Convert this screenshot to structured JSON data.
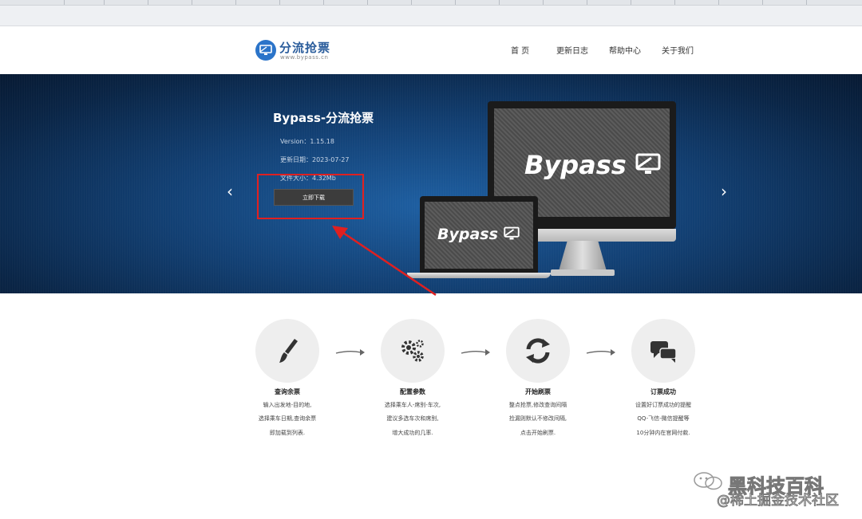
{
  "header": {
    "logo_text": "分流抢票",
    "logo_domain": "www.bypass.cn",
    "nav": [
      {
        "label": "首  页"
      },
      {
        "label": "更新日志"
      },
      {
        "label": "帮助中心"
      },
      {
        "label": "关于我们"
      }
    ]
  },
  "banner": {
    "title": "Bypass-分流抢票",
    "version": "Version：1.15.18",
    "update_date": "更新日期：2023-07-27",
    "file_size": "文件大小：4.32Mb",
    "download_label": "立即下载",
    "monitor_word": "Bypass",
    "laptop_word": "Bypass",
    "prev_arrow": "‹",
    "next_arrow": "›"
  },
  "steps": [
    {
      "icon": "brush-icon",
      "title": "查询余票",
      "lines": [
        "输入出发地-目的地,",
        "选择乘车日期,查询余票",
        "即加载到列表."
      ]
    },
    {
      "icon": "gears-icon",
      "title": "配置参数",
      "lines": [
        "选择乘车人-席别-车次,",
        "建议多选车次和席别,",
        "增大成功的几率."
      ]
    },
    {
      "icon": "refresh-icon",
      "title": "开始刷票",
      "lines": [
        "整点抢票,修改查询间隔",
        "捡漏则默认不修改间隔,",
        "点击开始刷票."
      ]
    },
    {
      "icon": "chat-bubbles-icon",
      "title": "订票成功",
      "lines": [
        "设置好订票成功的提醒",
        "QQ-飞信-微信提醒等",
        "10分钟内在官网付款."
      ]
    }
  ],
  "watermark": {
    "line1": "黑科技百科",
    "line2": "@稀土掘金技术社区"
  },
  "colors": {
    "brand_blue": "#2b74c9",
    "highlight_red": "#e02020",
    "banner_dark": "#0a2546"
  }
}
